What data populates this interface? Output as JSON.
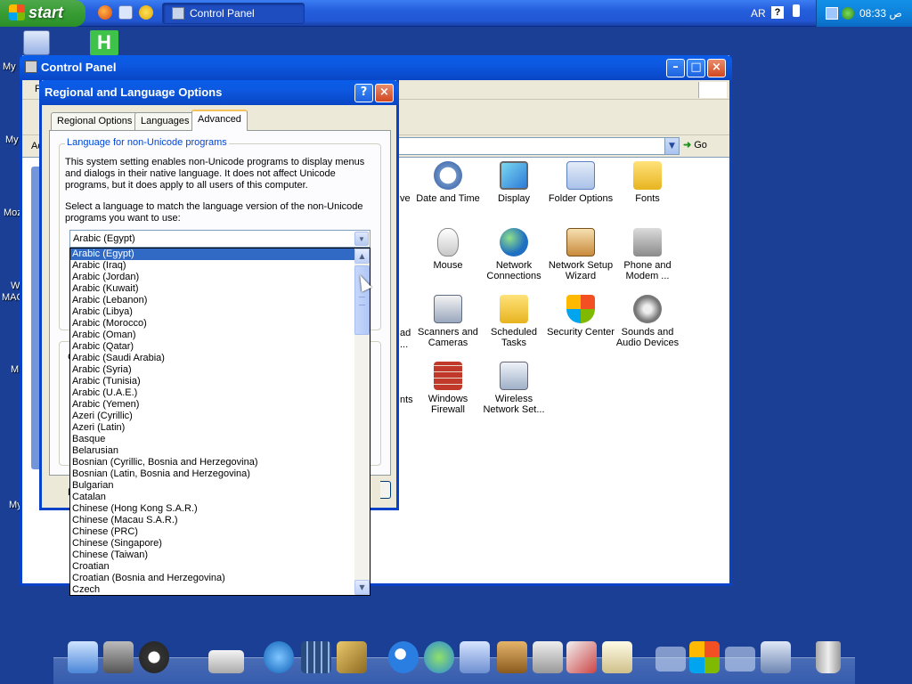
{
  "taskbar": {
    "start_label": "start",
    "task_label": "Control Panel",
    "language": "AR",
    "tray_help": "?",
    "clock": "08:33 ص"
  },
  "desktop": {
    "icons": [
      "My",
      "My",
      "Moz",
      "W",
      "MAC",
      "M",
      "My"
    ]
  },
  "control_panel": {
    "title": "Control Panel",
    "menu_cut": "Fi",
    "addr_cut": "Ad",
    "go_label": "Go",
    "items": [
      {
        "label": "Date and Time",
        "icon": "clock-icon"
      },
      {
        "label": "Display",
        "icon": "display-icon"
      },
      {
        "label": "Folder Options",
        "icon": "folder-options-icon"
      },
      {
        "label": "Fonts",
        "icon": "fonts-folder-icon"
      },
      {
        "label": "Mouse",
        "icon": "mouse-icon"
      },
      {
        "label": "Network Connections",
        "icon": "network-icon"
      },
      {
        "label": "Network Setup Wizard",
        "icon": "network-wizard-icon"
      },
      {
        "label": "Phone and Modem ...",
        "icon": "phone-icon"
      },
      {
        "label": "Scanners and Cameras",
        "icon": "scanner-icon"
      },
      {
        "label": "Scheduled Tasks",
        "icon": "tasks-folder-icon"
      },
      {
        "label": "Security Center",
        "icon": "shield-icon"
      },
      {
        "label": "Sounds and Audio Devices",
        "icon": "speaker-icon"
      },
      {
        "label": "Windows Firewall",
        "icon": "firewall-icon"
      },
      {
        "label": "Wireless Network Set...",
        "icon": "wireless-icon"
      }
    ],
    "cut_labels": [
      "ve",
      "ad",
      "...",
      "nts"
    ]
  },
  "dialog": {
    "title": "Regional and Language Options",
    "help": "?",
    "close": "×",
    "tabs": [
      "Regional Options",
      "Languages",
      "Advanced"
    ],
    "group_label": "Language for non-Unicode programs",
    "para1": "This system setting enables non-Unicode programs to display menus and dialogs in their native language. It does not affect Unicode programs, but it does apply to all users of this computer.",
    "para2": "Select a language to match the language version of the non-Unicode programs you want to use:",
    "combo_value": "Arabic (Egypt)",
    "side_letters": [
      "C",
      "D"
    ],
    "languages": [
      "Arabic (Egypt)",
      "Arabic (Iraq)",
      "Arabic (Jordan)",
      "Arabic (Kuwait)",
      "Arabic (Lebanon)",
      "Arabic (Libya)",
      "Arabic (Morocco)",
      "Arabic (Oman)",
      "Arabic (Qatar)",
      "Arabic (Saudi Arabia)",
      "Arabic (Syria)",
      "Arabic (Tunisia)",
      "Arabic (U.A.E.)",
      "Arabic (Yemen)",
      "Azeri (Cyrillic)",
      "Azeri (Latin)",
      "Basque",
      "Belarusian",
      "Bosnian (Cyrillic, Bosnia and Herzegovina)",
      "Bosnian (Latin, Bosnia and Herzegovina)",
      "Bulgarian",
      "Catalan",
      "Chinese (Hong Kong S.A.R.)",
      "Chinese (Macau S.A.R.)",
      "Chinese (PRC)",
      "Chinese (Singapore)",
      "Chinese (Taiwan)",
      "Croatian",
      "Croatian (Bosnia and Herzegovina)",
      "Czech"
    ],
    "selected_index": 0
  },
  "colors": {
    "selection": "#316ac5",
    "title_blue": "#0a5de9",
    "desktop": "#1a3f94"
  }
}
